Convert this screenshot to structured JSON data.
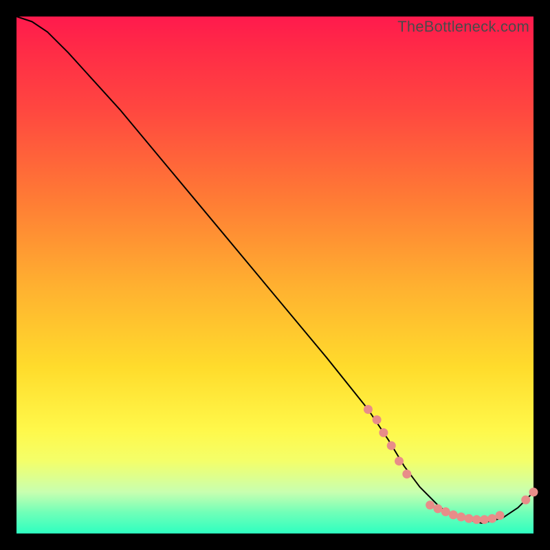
{
  "watermark": "TheBottleneck.com",
  "colors": {
    "marker": "#e88d89",
    "curve": "#000000"
  },
  "chart_data": {
    "type": "line",
    "title": "",
    "xlabel": "",
    "ylabel": "",
    "xlim": [
      0,
      100
    ],
    "ylim": [
      0,
      100
    ],
    "grid": false,
    "legend": false,
    "annotations": [],
    "series": [
      {
        "name": "bottleneck-curve",
        "x": [
          0,
          3,
          6,
          10,
          20,
          30,
          40,
          50,
          60,
          68,
          72,
          75,
          78,
          82,
          86,
          90,
          94,
          97,
          100
        ],
        "y": [
          100,
          99,
          97,
          93,
          82,
          70,
          58,
          46,
          34,
          24,
          18,
          13,
          9,
          5,
          3,
          2,
          3,
          5,
          8
        ]
      }
    ],
    "markers": [
      {
        "x": 68.0,
        "y": 24.0
      },
      {
        "x": 69.7,
        "y": 22.0
      },
      {
        "x": 71.0,
        "y": 19.5
      },
      {
        "x": 72.5,
        "y": 17.0
      },
      {
        "x": 74.0,
        "y": 14.0
      },
      {
        "x": 75.5,
        "y": 11.5
      },
      {
        "x": 80.0,
        "y": 5.5
      },
      {
        "x": 81.5,
        "y": 4.8
      },
      {
        "x": 83.0,
        "y": 4.2
      },
      {
        "x": 84.5,
        "y": 3.6
      },
      {
        "x": 86.0,
        "y": 3.2
      },
      {
        "x": 87.5,
        "y": 2.9
      },
      {
        "x": 89.0,
        "y": 2.7
      },
      {
        "x": 90.5,
        "y": 2.7
      },
      {
        "x": 92.0,
        "y": 2.9
      },
      {
        "x": 93.5,
        "y": 3.5
      },
      {
        "x": 98.5,
        "y": 6.5
      },
      {
        "x": 100.0,
        "y": 8.0
      }
    ]
  }
}
